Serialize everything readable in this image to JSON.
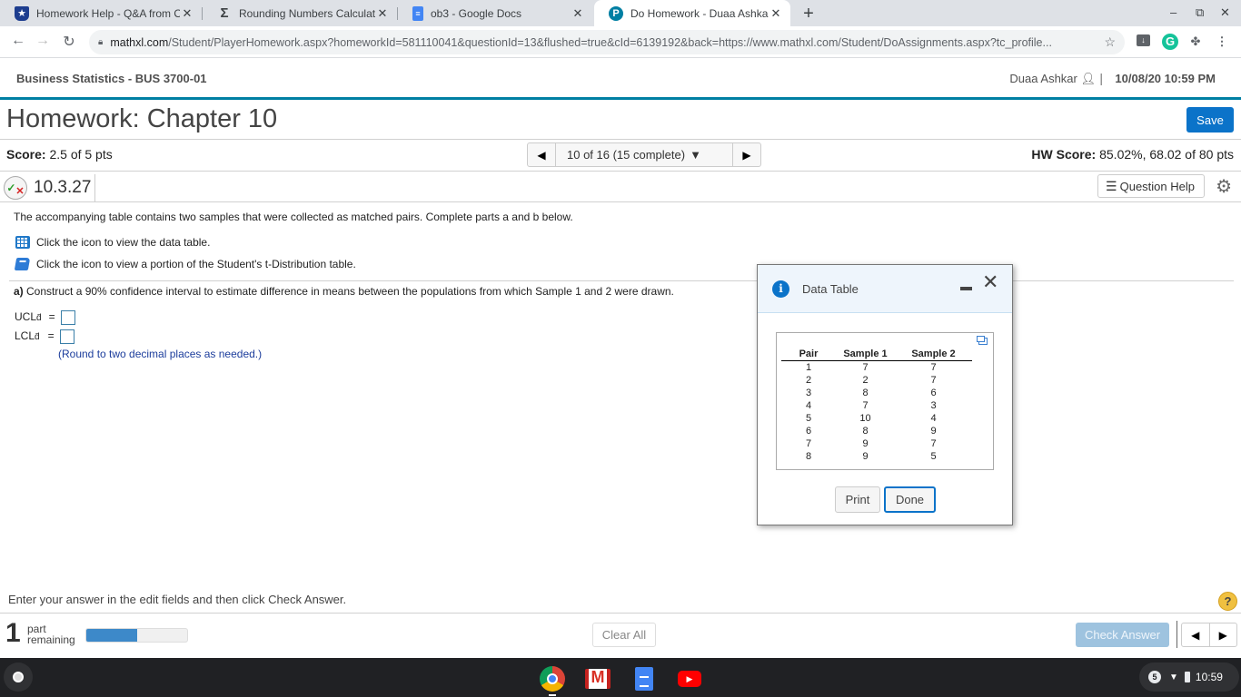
{
  "browser": {
    "tabs": [
      {
        "title": "Homework Help - Q&A from Onli",
        "icon": "bartleby-shield-icon",
        "active": false
      },
      {
        "title": "Rounding Numbers Calculator",
        "icon": "sigma-icon",
        "active": false
      },
      {
        "title": "ob3 - Google Docs",
        "icon": "google-docs-icon",
        "active": false
      },
      {
        "title": "Do Homework - Duaa Ashkar",
        "icon": "pearson-icon",
        "active": true
      }
    ],
    "new_tab": "+",
    "url_host": "mathxl.com",
    "url_rest": "/Student/PlayerHomework.aspx?homeworkId=581110041&questionId=13&flushed=true&cId=6139192&back=https://www.mathxl.com/Student/DoAssignments.aspx?tc_profile..."
  },
  "header": {
    "course": "Business Statistics - BUS 3700-01",
    "user": "Duaa Ashkar",
    "separator": "|",
    "datetime": "10/08/20 10:59 PM"
  },
  "homework": {
    "title": "Homework: Chapter 10",
    "save_label": "Save",
    "score_label": "Score:",
    "score_value": "2.5 of 5 pts",
    "question_nav": "10 of 16 (15 complete)",
    "hw_score_label": "HW Score:",
    "hw_score_value": "85.02%, 68.02 of 80 pts",
    "question_number": "10.3.27",
    "question_help": "Question Help"
  },
  "question": {
    "intro": "The accompanying table contains two samples that were collected as matched pairs. Complete parts a and b below.",
    "data_table_link": "Click the icon to view the data table.",
    "t_table_link": "Click the icon to view a portion of the Student's t-Distribution table.",
    "part_a_label": "a)",
    "part_a_text": "Construct a 90% confidence interval to estimate difference in means between the populations from which Sample 1 and 2 were drawn.",
    "ucl_label": "UCL",
    "lcl_label": "LCL",
    "subscript": "d̄",
    "equals": "=",
    "ucl_value": "",
    "lcl_value": "",
    "round_note": "(Round to two decimal places as needed.)"
  },
  "dialog": {
    "title": "Data Table",
    "columns": [
      "Pair",
      "Sample 1",
      "Sample 2"
    ],
    "rows": [
      [
        "1",
        "7",
        "7"
      ],
      [
        "2",
        "2",
        "7"
      ],
      [
        "3",
        "8",
        "6"
      ],
      [
        "4",
        "7",
        "3"
      ],
      [
        "5",
        "10",
        "4"
      ],
      [
        "6",
        "8",
        "9"
      ],
      [
        "7",
        "9",
        "7"
      ],
      [
        "8",
        "9",
        "5"
      ]
    ],
    "print_label": "Print",
    "done_label": "Done"
  },
  "footer": {
    "instruction": "Enter your answer in the edit fields and then click Check Answer.",
    "parts_remaining_count": "1",
    "parts_remaining_word1": "part",
    "parts_remaining_word2": "remaining",
    "progress_fraction": 0.5,
    "clear_all": "Clear All",
    "check_answer": "Check Answer",
    "help": "?"
  },
  "shelf": {
    "apps": [
      "chrome",
      "gmail",
      "google-docs",
      "youtube"
    ],
    "notification_count": "5",
    "time": "10:59"
  }
}
